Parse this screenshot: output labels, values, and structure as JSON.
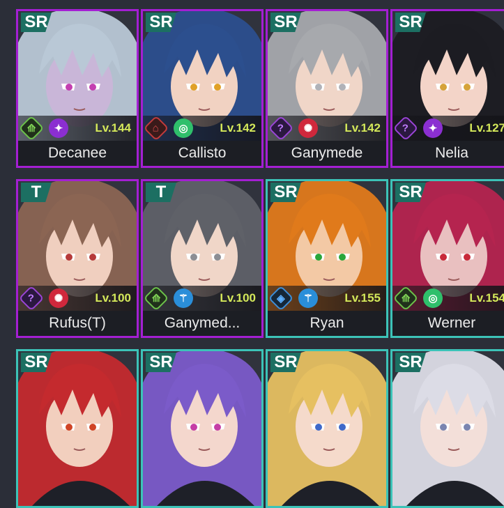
{
  "cards": [
    {
      "rarity": "SR",
      "name": "Decanee",
      "level": "Lv.144",
      "frame": "purple",
      "class_icon": "knight-icon",
      "class_kind": "",
      "element_icon": "dark-element-icon",
      "element": "dark",
      "hair": "#b9c8d6",
      "skin": "#c9b6d8",
      "eye": "#c43fb0"
    },
    {
      "rarity": "SR",
      "name": "Callisto",
      "level": "Lv.142",
      "frame": "purple",
      "class_icon": "support-icon",
      "class_kind": "support",
      "element_icon": "wind-element-icon",
      "element": "wind",
      "hair": "#2c4f8e",
      "skin": "#f1d2c2",
      "eye": "#e0a128"
    },
    {
      "rarity": "SR",
      "name": "Ganymede",
      "level": "Lv.142",
      "frame": "purple",
      "class_icon": "unknown-class-icon",
      "class_kind": "unknown",
      "element_icon": "fire-element-icon",
      "element": "fire",
      "hair": "#a7a9ad",
      "skin": "#f0d6c8",
      "eye": "#b0b2b8"
    },
    {
      "rarity": "SR",
      "name": "Nelia",
      "level": "Lv.127",
      "frame": "purple",
      "class_icon": "unknown-class-icon",
      "class_kind": "unknown",
      "element_icon": "dark-element-icon",
      "element": "dark",
      "hair": "#1c1c22",
      "skin": "#f3d4c8",
      "eye": "#d5a33a"
    },
    {
      "rarity": "T",
      "name": "Rufus(T)",
      "level": "Lv.100",
      "frame": "purple",
      "class_icon": "unknown-class-icon",
      "class_kind": "unknown",
      "element_icon": "fire-element-icon",
      "element": "fire",
      "hair": "#8b6553",
      "skin": "#f0cfbf",
      "eye": "#b63a3a"
    },
    {
      "rarity": "T",
      "name": "Ganymed...",
      "level": "Lv.100",
      "frame": "purple",
      "class_icon": "knight-icon",
      "class_kind": "",
      "element_icon": "water-element-icon",
      "element": "water",
      "hair": "#5f6168",
      "skin": "#f0d6c8",
      "eye": "#8c8e94"
    },
    {
      "rarity": "SR",
      "name": "Ryan",
      "level": "Lv.155",
      "frame": "teal",
      "class_icon": "tank-icon",
      "class_kind": "tank",
      "element_icon": "water-element-icon",
      "element": "water",
      "hair": "#e07a1b",
      "skin": "#f3c9a5",
      "eye": "#2aa63b"
    },
    {
      "rarity": "SR",
      "name": "Werner",
      "level": "Lv.154",
      "frame": "teal",
      "class_icon": "knight-icon",
      "class_kind": "",
      "element_icon": "wind-element-icon",
      "element": "wind",
      "hair": "#b5244f",
      "skin": "#e9c0c0",
      "eye": "#c82a3a"
    },
    {
      "rarity": "SR",
      "name": "",
      "level": "",
      "frame": "teal",
      "class_icon": "",
      "class_kind": "",
      "element_icon": "",
      "element": "",
      "hair": "#c42a2e",
      "skin": "#f2cfbe",
      "eye": "#d04426"
    },
    {
      "rarity": "SR",
      "name": "",
      "level": "",
      "frame": "teal",
      "class_icon": "",
      "class_kind": "",
      "element_icon": "",
      "element": "",
      "hair": "#7b5bc9",
      "skin": "#f4d7cd",
      "eye": "#c53ea6"
    },
    {
      "rarity": "SR",
      "name": "",
      "level": "",
      "frame": "teal",
      "class_icon": "",
      "class_kind": "",
      "element_icon": "",
      "element": "",
      "hair": "#e6c061",
      "skin": "#f5dacb",
      "eye": "#3f69c9"
    },
    {
      "rarity": "SR",
      "name": "",
      "level": "",
      "frame": "teal",
      "class_icon": "",
      "class_kind": "",
      "element_icon": "",
      "element": "",
      "hair": "#dcdce6",
      "skin": "#f3dfd9",
      "eye": "#7a85b0"
    }
  ],
  "colors": {
    "background": "#2b2e38",
    "purple_frame": "#a41fd3",
    "teal_frame": "#3cc3b8",
    "level_text": "#d4e85a"
  }
}
